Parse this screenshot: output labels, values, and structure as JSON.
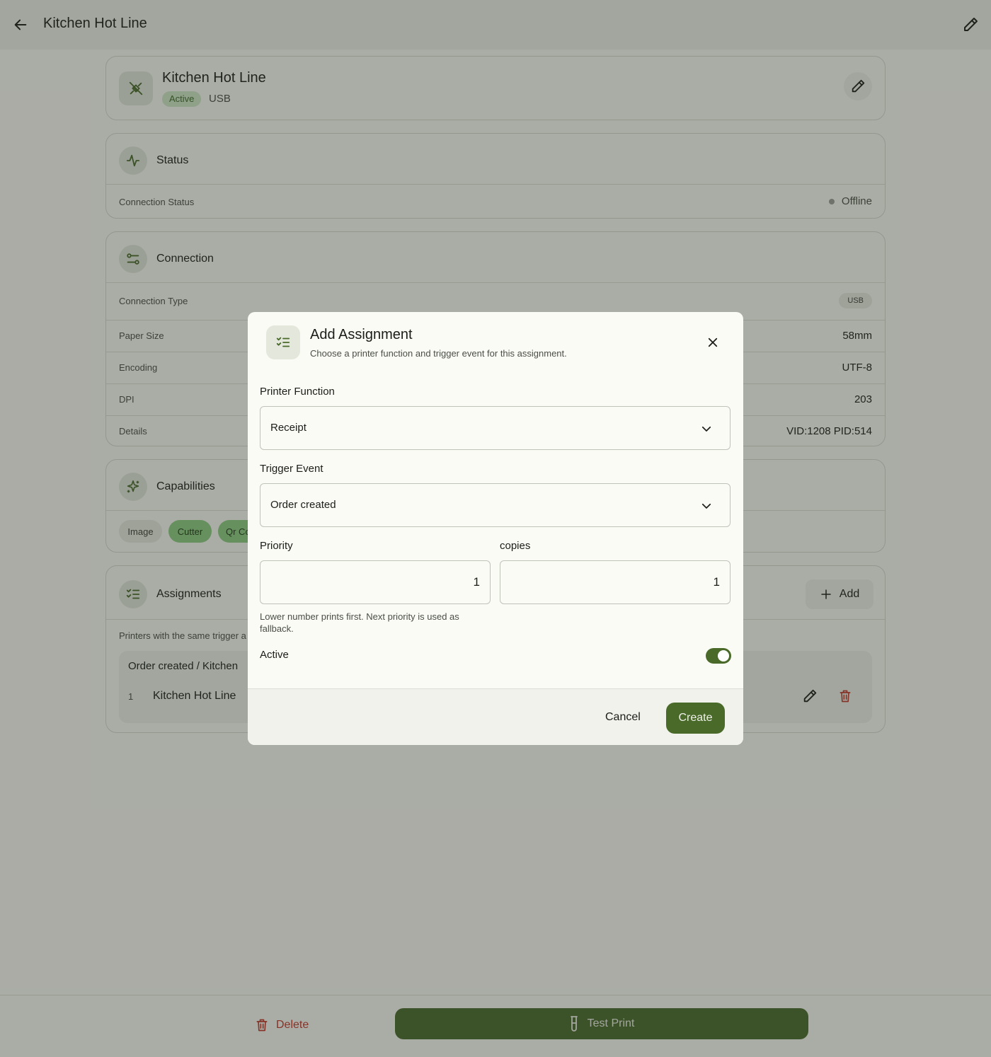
{
  "topbar": {
    "title": "Kitchen Hot Line"
  },
  "printer": {
    "name": "Kitchen Hot Line",
    "status_badge": "Active",
    "connection": "USB"
  },
  "status_card": {
    "title": "Status",
    "connection_status_label": "Connection Status",
    "connection_status_value": "Offline"
  },
  "connection_card": {
    "title": "Connection",
    "rows": [
      {
        "label": "Connection Type",
        "value": "USB"
      },
      {
        "label": "Paper Size",
        "value": "58mm"
      },
      {
        "label": "Encoding",
        "value": "UTF-8"
      },
      {
        "label": "DPI",
        "value": "203"
      },
      {
        "label": "Details",
        "value": "VID:1208 PID:514"
      }
    ]
  },
  "capabilities_card": {
    "title": "Capabilities",
    "chips": [
      "Image",
      "Cutter",
      "Qr Co"
    ]
  },
  "assignments_card": {
    "title": "Assignments",
    "add_label": "Add",
    "note": "Printers with the same trigger a",
    "group_title": "Order created / Kitchen",
    "item_index": "1",
    "item_name": "Kitchen Hot Line"
  },
  "footer": {
    "delete_label": "Delete",
    "test_print_label": "Test Print"
  },
  "modal": {
    "title": "Add Assignment",
    "subtitle": "Choose a printer function and trigger event for this assignment.",
    "printer_function_label": "Printer Function",
    "printer_function_value": "Receipt",
    "trigger_event_label": "Trigger Event",
    "trigger_event_value": "Order created",
    "priority_label": "Priority",
    "priority_value": "1",
    "copies_label": "copies",
    "copies_value": "1",
    "priority_help": "Lower number prints first. Next priority is used as fallback.",
    "active_label": "Active",
    "cancel_label": "Cancel",
    "create_label": "Create"
  },
  "colors": {
    "primary": "#4a6a2a",
    "chip_green": "#8fce84",
    "danger": "#c0392b"
  }
}
